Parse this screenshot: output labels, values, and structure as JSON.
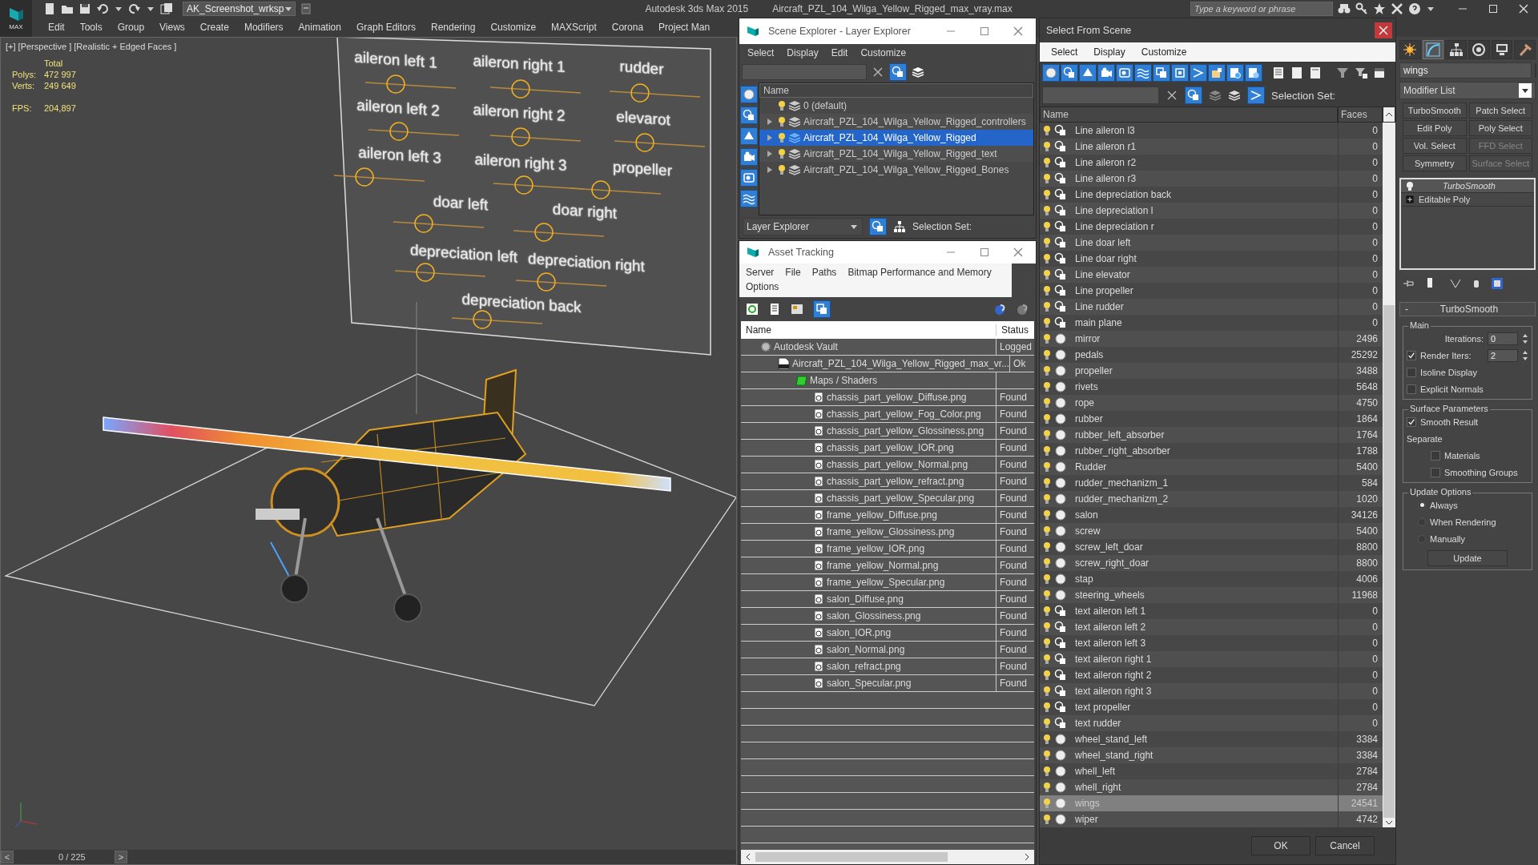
{
  "app": {
    "logo_text": "MAX",
    "workspace": "AK_Screenshot_wrksp",
    "title": "Autodesk 3ds Max  2015",
    "file": "Aircraft_PZL_104_Wilga_Yellow_Rigged_max_vray.max",
    "search": {
      "placeholder": "Type a keyword or phrase"
    }
  },
  "menu": [
    "Edit",
    "Tools",
    "Group",
    "Views",
    "Create",
    "Modifiers",
    "Animation",
    "Graph Editors",
    "Rendering",
    "Customize",
    "MAXScript",
    "Corona",
    "Project Man"
  ],
  "viewport": {
    "label": "[+] [Perspective ] [Realistic + Edged Faces ]",
    "stats_title": "Total",
    "stats": [
      {
        "label": "Polys:",
        "value": "472 997"
      },
      {
        "label": "Verts:",
        "value": "249 649"
      }
    ],
    "fps": {
      "label": "FPS:",
      "value": "204,897"
    },
    "board_labels": [
      "aileron left 1",
      "aileron right 1",
      "rudder",
      "aileron left 2",
      "aileron right 2",
      "elevarot",
      "aileron left 3",
      "aileron right 3",
      "propeller",
      "doar left",
      "doar right",
      "depreciation left",
      "depreciation right",
      "depreciation back"
    ]
  },
  "timeline": {
    "prev": "<",
    "frame": "0 / 225",
    "next": ">"
  },
  "scene_explorer": {
    "title": "Scene Explorer - Layer Explorer",
    "menu": [
      "Select",
      "Display",
      "Edit",
      "Customize"
    ],
    "column": "Name",
    "layers": [
      {
        "name": "0 (default)",
        "expandable": false,
        "selected": false
      },
      {
        "name": "Aircraft_PZL_104_Wilga_Yellow_Rigged_controllers",
        "expandable": true,
        "selected": false
      },
      {
        "name": "Aircraft_PZL_104_Wilga_Yellow_Rigged",
        "expandable": true,
        "selected": true
      },
      {
        "name": "Aircraft_PZL_104_Wilga_Yellow_Rigged_text",
        "expandable": true,
        "selected": false
      },
      {
        "name": "Aircraft_PZL_104_Wilga_Yellow_Rigged_Bones",
        "expandable": true,
        "selected": false
      }
    ],
    "mode": "Layer Explorer",
    "selection_set_label": "Selection Set:"
  },
  "asset_tracking": {
    "title": "Asset Tracking",
    "menu": [
      "Server",
      "File",
      "Paths",
      "Bitmap Performance and Memory",
      "Options"
    ],
    "columns": [
      "Name",
      "Status"
    ],
    "tree": [
      {
        "name": "Autodesk Vault",
        "status": "Logged",
        "kind": "vault",
        "children": [
          {
            "name": "Aircraft_PZL_104_Wilga_Yellow_Rigged_max_vr...",
            "status": "Ok",
            "kind": "max",
            "children": [
              {
                "name": "Maps / Shaders",
                "kind": "folder",
                "children": [
                  {
                    "name": "chassis_part_yellow_Diffuse.png",
                    "status": "Found",
                    "kind": "image"
                  },
                  {
                    "name": "chassis_part_yellow_Fog_Color.png",
                    "status": "Found",
                    "kind": "image"
                  },
                  {
                    "name": "chassis_part_yellow_Glossiness.png",
                    "status": "Found",
                    "kind": "image"
                  },
                  {
                    "name": "chassis_part_yellow_IOR.png",
                    "status": "Found",
                    "kind": "image"
                  },
                  {
                    "name": "chassis_part_yellow_Normal.png",
                    "status": "Found",
                    "kind": "image"
                  },
                  {
                    "name": "chassis_part_yellow_refract.png",
                    "status": "Found",
                    "kind": "image"
                  },
                  {
                    "name": "chassis_part_yellow_Specular.png",
                    "status": "Found",
                    "kind": "image"
                  },
                  {
                    "name": "frame_yellow_Diffuse.png",
                    "status": "Found",
                    "kind": "image"
                  },
                  {
                    "name": "frame_yellow_Glossiness.png",
                    "status": "Found",
                    "kind": "image"
                  },
                  {
                    "name": "frame_yellow_IOR.png",
                    "status": "Found",
                    "kind": "image"
                  },
                  {
                    "name": "frame_yellow_Normal.png",
                    "status": "Found",
                    "kind": "image"
                  },
                  {
                    "name": "frame_yellow_Specular.png",
                    "status": "Found",
                    "kind": "image"
                  },
                  {
                    "name": "salon_Diffuse.png",
                    "status": "Found",
                    "kind": "image"
                  },
                  {
                    "name": "salon_Glossiness.png",
                    "status": "Found",
                    "kind": "image"
                  },
                  {
                    "name": "salon_IOR.png",
                    "status": "Found",
                    "kind": "image"
                  },
                  {
                    "name": "salon_Normal.png",
                    "status": "Found",
                    "kind": "image"
                  },
                  {
                    "name": "salon_refract.png",
                    "status": "Found",
                    "kind": "image"
                  },
                  {
                    "name": "salon_Specular.png",
                    "status": "Found",
                    "kind": "image"
                  }
                ]
              }
            ]
          }
        ]
      }
    ]
  },
  "select_from_scene": {
    "title": "Select From Scene",
    "menu": [
      "Select",
      "Display",
      "Customize"
    ],
    "selection_set_label": "Selection Set:",
    "columns": [
      "Name",
      "Faces"
    ],
    "objects": [
      {
        "name": "Line aileron l3",
        "faces": "0",
        "kind": "shape",
        "selected": false
      },
      {
        "name": "Line aileron r1",
        "faces": "0",
        "kind": "shape",
        "selected": false
      },
      {
        "name": "Line aileron r2",
        "faces": "0",
        "kind": "shape",
        "selected": false
      },
      {
        "name": "Line aileron r3",
        "faces": "0",
        "kind": "shape",
        "selected": false
      },
      {
        "name": "Line depreciation back",
        "faces": "0",
        "kind": "shape",
        "selected": false
      },
      {
        "name": "Line depreciation l",
        "faces": "0",
        "kind": "shape",
        "selected": false
      },
      {
        "name": "Line depreciation r",
        "faces": "0",
        "kind": "shape",
        "selected": false
      },
      {
        "name": "Line doar left",
        "faces": "0",
        "kind": "shape",
        "selected": false
      },
      {
        "name": "Line doar right",
        "faces": "0",
        "kind": "shape",
        "selected": false
      },
      {
        "name": "Line elevator",
        "faces": "0",
        "kind": "shape",
        "selected": false
      },
      {
        "name": "Line propeller",
        "faces": "0",
        "kind": "shape",
        "selected": false
      },
      {
        "name": "Line rudder",
        "faces": "0",
        "kind": "shape",
        "selected": false
      },
      {
        "name": "main plane",
        "faces": "0",
        "kind": "shape",
        "selected": false
      },
      {
        "name": "mirror",
        "faces": "2496",
        "kind": "geometry",
        "selected": false
      },
      {
        "name": "pedals",
        "faces": "25292",
        "kind": "geometry",
        "selected": false
      },
      {
        "name": "propeller",
        "faces": "3488",
        "kind": "geometry",
        "selected": false
      },
      {
        "name": "rivets",
        "faces": "5648",
        "kind": "geometry",
        "selected": false
      },
      {
        "name": "rope",
        "faces": "4750",
        "kind": "geometry",
        "selected": false
      },
      {
        "name": "rubber",
        "faces": "1864",
        "kind": "geometry",
        "selected": false
      },
      {
        "name": "rubber_left_absorber",
        "faces": "1764",
        "kind": "geometry",
        "selected": false
      },
      {
        "name": "rubber_right_absorber",
        "faces": "1788",
        "kind": "geometry",
        "selected": false
      },
      {
        "name": "Rudder",
        "faces": "5400",
        "kind": "geometry",
        "selected": false
      },
      {
        "name": "rudder_mechanizm_1",
        "faces": "584",
        "kind": "geometry",
        "selected": false
      },
      {
        "name": "rudder_mechanizm_2",
        "faces": "1020",
        "kind": "geometry",
        "selected": false
      },
      {
        "name": "salon",
        "faces": "34126",
        "kind": "geometry",
        "selected": false
      },
      {
        "name": "screw",
        "faces": "5400",
        "kind": "geometry",
        "selected": false
      },
      {
        "name": "screw_left_doar",
        "faces": "8800",
        "kind": "geometry",
        "selected": false
      },
      {
        "name": "screw_right_doar",
        "faces": "8800",
        "kind": "geometry",
        "selected": false
      },
      {
        "name": "stap",
        "faces": "4006",
        "kind": "geometry",
        "selected": false
      },
      {
        "name": "steering_wheels",
        "faces": "11968",
        "kind": "geometry",
        "selected": false
      },
      {
        "name": "text aileron left 1",
        "faces": "0",
        "kind": "shape",
        "selected": false
      },
      {
        "name": "text aileron left 2",
        "faces": "0",
        "kind": "shape",
        "selected": false
      },
      {
        "name": "text aileron left 3",
        "faces": "0",
        "kind": "shape",
        "selected": false
      },
      {
        "name": "text aileron right 1",
        "faces": "0",
        "kind": "shape",
        "selected": false
      },
      {
        "name": "text aileron right 2",
        "faces": "0",
        "kind": "shape",
        "selected": false
      },
      {
        "name": "text aileron right 3",
        "faces": "0",
        "kind": "shape",
        "selected": false
      },
      {
        "name": "text propeller",
        "faces": "0",
        "kind": "shape",
        "selected": false
      },
      {
        "name": "text rudder",
        "faces": "0",
        "kind": "shape",
        "selected": false
      },
      {
        "name": "wheel_stand_left",
        "faces": "3384",
        "kind": "geometry",
        "selected": false
      },
      {
        "name": "wheel_stand_right",
        "faces": "3384",
        "kind": "geometry",
        "selected": false
      },
      {
        "name": "whell_left",
        "faces": "2784",
        "kind": "geometry",
        "selected": false
      },
      {
        "name": "whell_right",
        "faces": "2784",
        "kind": "geometry",
        "selected": false
      },
      {
        "name": "wings",
        "faces": "24541",
        "kind": "geometry",
        "selected": true
      },
      {
        "name": "wiper",
        "faces": "4742",
        "kind": "geometry",
        "selected": false
      }
    ],
    "buttons": [
      "OK",
      "Cancel"
    ]
  },
  "command_panel": {
    "tabs": [
      {
        "selected": false
      },
      {
        "selected": true
      },
      {
        "selected": false
      },
      {
        "selected": false
      },
      {
        "selected": false
      },
      {
        "selected": false
      }
    ],
    "object_name": "wings",
    "modifier_list": "Modifier List",
    "modifier_buttons": [
      {
        "label": "TurboSmooth",
        "disabled": false
      },
      {
        "label": "Patch Select",
        "disabled": false
      },
      {
        "label": "Edit Poly",
        "disabled": false
      },
      {
        "label": "Poly Select",
        "disabled": false
      },
      {
        "label": "Vol. Select",
        "disabled": false
      },
      {
        "label": "FFD Select",
        "disabled": true
      },
      {
        "label": "Symmetry",
        "disabled": false
      },
      {
        "label": "Surface Select",
        "disabled": true
      }
    ],
    "stack": [
      {
        "label": "TurboSmooth",
        "kind": "modifier"
      },
      {
        "label": "Editable Poly",
        "kind": "base"
      }
    ],
    "rollout": {
      "toggle": "-",
      "title": "TurboSmooth",
      "groups": [
        {
          "title": "Main",
          "controls": [
            {
              "kind": "spinner",
              "label": "Iterations:",
              "value": "0"
            },
            {
              "kind": "checkspinner",
              "label": "Render Iters:",
              "value": "2",
              "checked": true
            },
            {
              "kind": "checkbox",
              "label": "Isoline Display",
              "checked": false
            },
            {
              "kind": "checkbox",
              "label": "Explicit Normals",
              "checked": false
            }
          ]
        },
        {
          "title": "Surface Parameters",
          "controls": [
            {
              "kind": "checkbox",
              "label": "Smooth Result",
              "checked": true
            },
            {
              "kind": "note",
              "label": "Separate"
            },
            {
              "kind": "subcheckbox",
              "label": "Materials",
              "checked": false
            },
            {
              "kind": "subcheckbox",
              "label": "Smoothing Groups",
              "checked": false
            }
          ]
        },
        {
          "title": "Update Options",
          "controls": [
            {
              "kind": "radio",
              "label": "Always",
              "selected": true
            },
            {
              "kind": "radio",
              "label": "When Rendering",
              "selected": false
            },
            {
              "kind": "radio",
              "label": "Manually",
              "selected": false
            },
            {
              "kind": "button",
              "label": "Update"
            }
          ]
        }
      ]
    }
  }
}
